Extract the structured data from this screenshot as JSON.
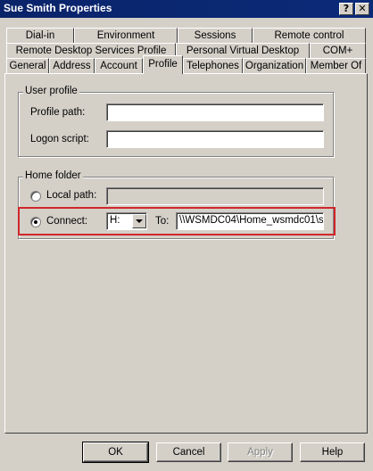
{
  "window": {
    "title": "Sue Smith Properties",
    "help_glyph": "?",
    "close_glyph": "✕"
  },
  "tabs": {
    "row1": [
      "Dial-in",
      "Environment",
      "Sessions",
      "Remote control"
    ],
    "row2": [
      "Remote Desktop Services Profile",
      "Personal Virtual Desktop",
      "COM+"
    ],
    "row3": [
      "General",
      "Address",
      "Account",
      "Profile",
      "Telephones",
      "Organization",
      "Member Of"
    ],
    "active": "Profile"
  },
  "user_profile": {
    "group_label": "User profile",
    "profile_path_label": "Profile path:",
    "profile_path_value": "",
    "logon_script_label": "Logon script:",
    "logon_script_value": ""
  },
  "home_folder": {
    "group_label": "Home folder",
    "local_path_label": "Local path:",
    "local_path_value": "",
    "connect_label": "Connect:",
    "connect_selected": true,
    "drive_value": "H:",
    "to_label": "To:",
    "to_value": "\\\\WSMDC04\\Home_wsmdc01\\s"
  },
  "buttons": {
    "ok": "OK",
    "cancel": "Cancel",
    "apply": "Apply",
    "help": "Help"
  },
  "colors": {
    "titlebar": "#0a246a",
    "highlight": "#d0262b",
    "face": "#d4d0c8"
  }
}
